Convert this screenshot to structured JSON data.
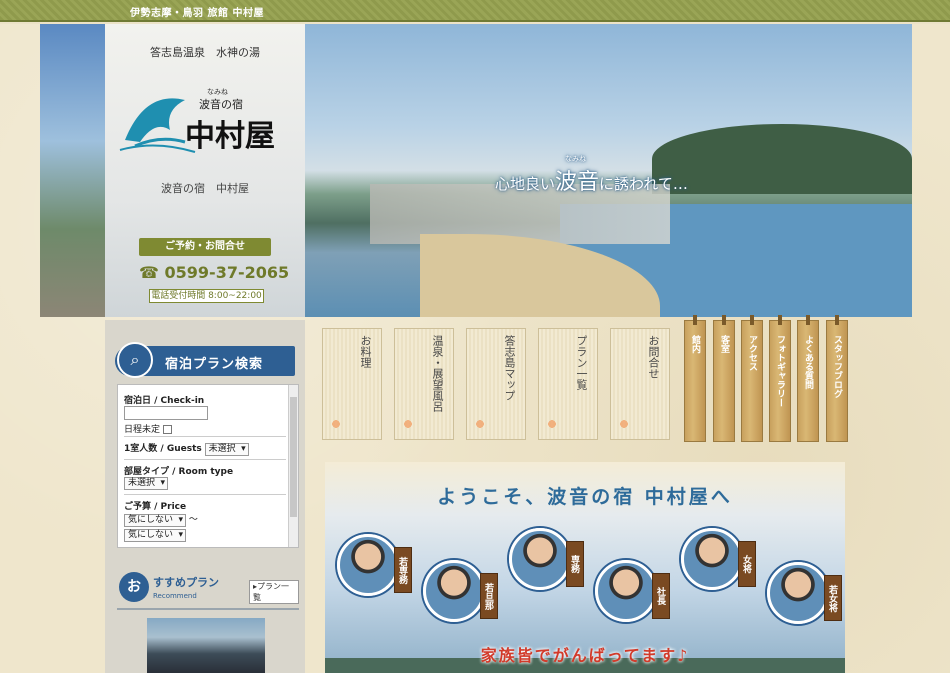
{
  "header": {
    "site_title": "伊勢志摩・鳥羽 旅館 中村屋"
  },
  "hero": {
    "tagline_pre": "心地良い",
    "tagline_big": "波音",
    "tagline_ruby": "なみね",
    "tagline_post": "に誘われて…"
  },
  "logo": {
    "subtitle": "答志島温泉　水神の湯",
    "ruby": "なみね",
    "brand_small": "波音の宿",
    "brand_big": "中村屋",
    "name": "波音の宿　中村屋"
  },
  "contact": {
    "reserve_label": "ご予約・お問合せ",
    "phone": "0599-37-2065",
    "hours": "電話受付時間 8:00~22:00"
  },
  "search": {
    "title": "宿泊プラン検索",
    "checkin_label": "宿泊日 / Check-in",
    "checkin_value": "",
    "undecided_label": "日程未定",
    "guests_label": "1室人数 / Guests",
    "guests_value": "未選択",
    "roomtype_label": "部屋タイプ / Room type",
    "roomtype_value": "未選択",
    "price_label": "ご予算 / Price",
    "price_min": "気にしない",
    "price_sep": "～",
    "price_max": "気にしない"
  },
  "recommend": {
    "o": "お",
    "title": "すすめプラン",
    "subtitle": "Recommend",
    "list_link": "▸プラン一覧"
  },
  "menu": [
    {
      "label": "お料理"
    },
    {
      "label": "温泉・展望風呂"
    },
    {
      "label": "答志島マップ"
    },
    {
      "label": "プラン一覧"
    },
    {
      "label": "お問合せ"
    }
  ],
  "tags": [
    {
      "label": "館内"
    },
    {
      "label": "客室"
    },
    {
      "label": "アクセス"
    },
    {
      "label": "フォトギャラリー"
    },
    {
      "label": "よくある質問"
    },
    {
      "label": "スタッフブログ"
    }
  ],
  "welcome": {
    "title": "ようこそ、波音の宿 中村屋へ",
    "family": "家族皆でがんばってます♪",
    "staff": [
      {
        "role": "若専務"
      },
      {
        "role": "若旦那"
      },
      {
        "role": "専務"
      },
      {
        "role": "社長"
      },
      {
        "role": "女将"
      },
      {
        "role": "若女将"
      }
    ]
  }
}
